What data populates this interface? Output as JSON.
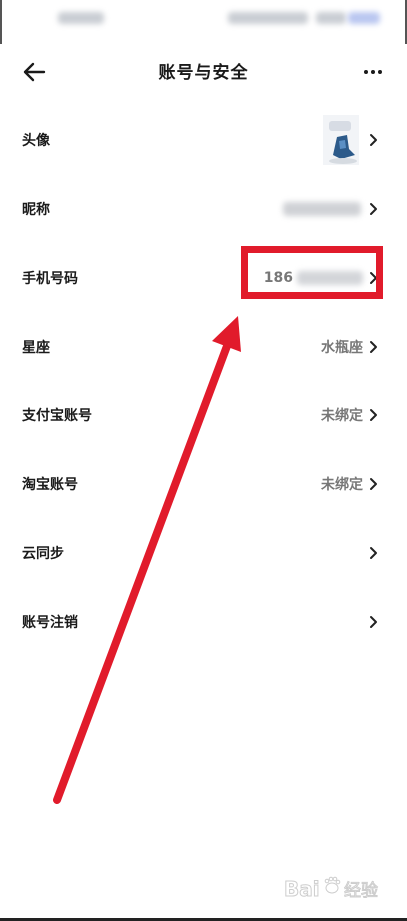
{
  "header": {
    "title": "账号与安全"
  },
  "settings": {
    "items": [
      {
        "label": "头像",
        "value": ""
      },
      {
        "label": "昵称",
        "value": ""
      },
      {
        "label": "手机号码",
        "value": "186"
      },
      {
        "label": "星座",
        "value": "水瓶座"
      },
      {
        "label": "支付宝账号",
        "value": "未绑定"
      },
      {
        "label": "淘宝账号",
        "value": "未绑定"
      },
      {
        "label": "云同步",
        "value": ""
      },
      {
        "label": "账号注销",
        "value": ""
      }
    ]
  },
  "annotation": {
    "color": "#e11b2b"
  },
  "watermark": {
    "text": "Baidu 经验"
  },
  "icons": {
    "back": "back-arrow-icon",
    "more": "more-dots-icon",
    "chevron": "chevron-right-icon"
  }
}
